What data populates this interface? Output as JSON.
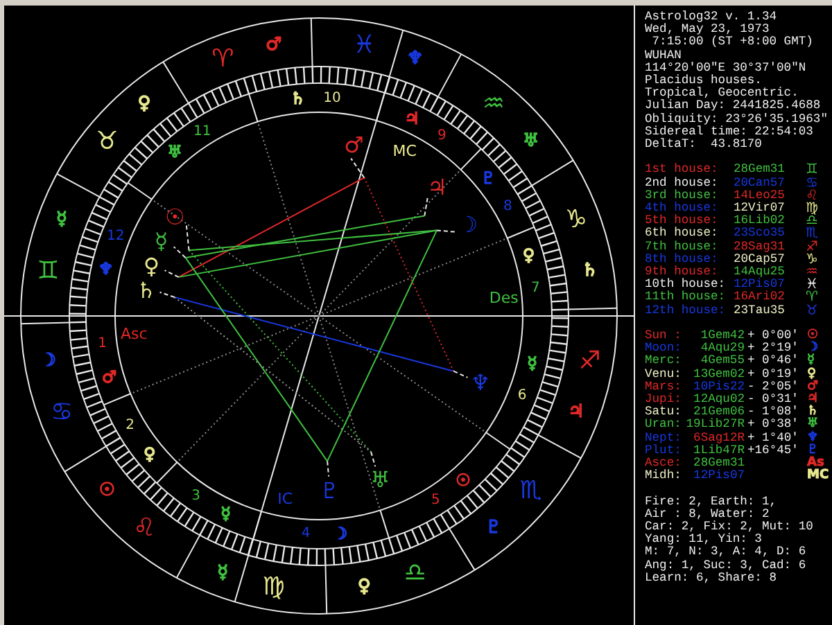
{
  "chart": {
    "signs": [
      {
        "glyph": "♈",
        "color": "#e02828"
      },
      {
        "glyph": "♉",
        "color": "#e8e890"
      },
      {
        "glyph": "♊",
        "color": "#40c040"
      },
      {
        "glyph": "♋",
        "color": "#1838e0"
      },
      {
        "glyph": "♌",
        "color": "#e02828"
      },
      {
        "glyph": "♍",
        "color": "#e8e890"
      },
      {
        "glyph": "♎",
        "color": "#40c040"
      },
      {
        "glyph": "♏",
        "color": "#1838e0"
      },
      {
        "glyph": "♐",
        "color": "#e02828"
      },
      {
        "glyph": "♑",
        "color": "#e8e890"
      },
      {
        "glyph": "♒",
        "color": "#40c040"
      },
      {
        "glyph": "♓",
        "color": "#1838e0"
      }
    ],
    "sign_rulers": [
      {
        "glyph": "♂",
        "color": "#e02828"
      },
      {
        "glyph": "♀",
        "color": "#e8e890"
      },
      {
        "glyph": "☿",
        "color": "#40c040"
      },
      {
        "glyph": "☽",
        "color": "#1838e0"
      },
      {
        "glyph": "☉",
        "color": "#e02828"
      },
      {
        "glyph": "☿",
        "color": "#40c040"
      },
      {
        "glyph": "♀",
        "color": "#e8e890"
      },
      {
        "glyph": "♇",
        "color": "#1838e0"
      },
      {
        "glyph": "♃",
        "color": "#e02828"
      },
      {
        "glyph": "♄",
        "color": "#e8e890"
      },
      {
        "glyph": "♅",
        "color": "#40c040"
      },
      {
        "glyph": "♆",
        "color": "#1838e0"
      }
    ],
    "houses": [
      {
        "number": "1",
        "color": "#e02828"
      },
      {
        "number": "2",
        "color": "#e8e890"
      },
      {
        "number": "3",
        "color": "#40c040"
      },
      {
        "number": "4",
        "color": "#1838e0"
      },
      {
        "number": "5",
        "color": "#e02828"
      },
      {
        "number": "6",
        "color": "#e8e890"
      },
      {
        "number": "7",
        "color": "#40c040"
      },
      {
        "number": "8",
        "color": "#1838e0"
      },
      {
        "number": "9",
        "color": "#e02828"
      },
      {
        "number": "10",
        "color": "#e8e890"
      },
      {
        "number": "11",
        "color": "#40c040"
      },
      {
        "number": "12",
        "color": "#1838e0"
      }
    ],
    "house_rulers": [
      {
        "glyph": "♂",
        "color": "#e02828"
      },
      {
        "glyph": "♀",
        "color": "#e8e890"
      },
      {
        "glyph": "☿",
        "color": "#40c040"
      },
      {
        "glyph": "☽",
        "color": "#1838e0"
      },
      {
        "glyph": "☉",
        "color": "#e02828"
      },
      {
        "glyph": "☿",
        "color": "#40c040"
      },
      {
        "glyph": "♀",
        "color": "#e8e890"
      },
      {
        "glyph": "♇",
        "color": "#1838e0"
      },
      {
        "glyph": "♃",
        "color": "#e02828"
      },
      {
        "glyph": "♄",
        "color": "#e8e890"
      },
      {
        "glyph": "♅",
        "color": "#40c040"
      },
      {
        "glyph": "♆",
        "color": "#1838e0"
      }
    ],
    "angles": [
      {
        "label": "Asc",
        "color": "#e02828"
      },
      {
        "label": "MC",
        "color": "#e8e890"
      },
      {
        "label": "Des",
        "color": "#40c040"
      },
      {
        "label": "IC",
        "color": "#1838e0"
      }
    ],
    "planets": [
      {
        "glyph": "☉",
        "color": "#e02828"
      },
      {
        "glyph": "☽",
        "color": "#1838e0"
      },
      {
        "glyph": "☿",
        "color": "#40c040"
      },
      {
        "glyph": "♀",
        "color": "#e8e890"
      },
      {
        "glyph": "♂",
        "color": "#e02828"
      },
      {
        "glyph": "♃",
        "color": "#e02828"
      },
      {
        "glyph": "♄",
        "color": "#e8e890"
      },
      {
        "glyph": "♅",
        "color": "#40c040"
      },
      {
        "glyph": "♆",
        "color": "#1838e0"
      },
      {
        "glyph": "♇",
        "color": "#1838e0"
      }
    ]
  },
  "info": {
    "header": [
      "Astrolog32 v. 1.34",
      "Wed, May 23, 1973",
      " 7:15:00 (ST +8:00 GMT)",
      "WUHAN",
      "114°20'00\"E 30°37'00\"N",
      "Placidus houses.",
      "Tropical, Geocentric.",
      "Julian Day: 2441825.4688",
      "Obliquity: 23°26'35.1963\"",
      "Sidereal time: 22:54:03",
      "DeltaT:  43.8170"
    ],
    "houses": [
      {
        "label": {
          "text": "1st house:",
          "color": "#e02828"
        },
        "value": {
          "text": "28Gem31",
          "color": "#40c040"
        },
        "glyph": {
          "text": "♊",
          "color": "#40c040"
        }
      },
      {
        "label": {
          "text": "2nd house:",
          "color": "#f0f0f0"
        },
        "value": {
          "text": "20Can57",
          "color": "#1838e0"
        },
        "glyph": {
          "text": "♋",
          "color": "#1838e0"
        }
      },
      {
        "label": {
          "text": "3rd house:",
          "color": "#40c040"
        },
        "value": {
          "text": "14Leo25",
          "color": "#e02828"
        },
        "glyph": {
          "text": "♌",
          "color": "#e02828"
        }
      },
      {
        "label": {
          "text": "4th house:",
          "color": "#1838e0"
        },
        "value": {
          "text": "12Vir07",
          "color": "#f0f0c8"
        },
        "glyph": {
          "text": "♍",
          "color": "#e8e890"
        }
      },
      {
        "label": {
          "text": "5th house:",
          "color": "#e02828"
        },
        "value": {
          "text": "16Lib02",
          "color": "#40c040"
        },
        "glyph": {
          "text": "♎",
          "color": "#40c040"
        }
      },
      {
        "label": {
          "text": "6th house:",
          "color": "#f0f0c8"
        },
        "value": {
          "text": "23Sco35",
          "color": "#1838e0"
        },
        "glyph": {
          "text": "♏",
          "color": "#1838e0"
        }
      },
      {
        "label": {
          "text": "7th house:",
          "color": "#40c040"
        },
        "value": {
          "text": "28Sag31",
          "color": "#e02828"
        },
        "glyph": {
          "text": "♐",
          "color": "#e02828"
        }
      },
      {
        "label": {
          "text": "8th house:",
          "color": "#1838e0"
        },
        "value": {
          "text": "20Cap57",
          "color": "#f0f0c8"
        },
        "glyph": {
          "text": "♑",
          "color": "#e8e890"
        }
      },
      {
        "label": {
          "text": "9th house:",
          "color": "#e02828"
        },
        "value": {
          "text": "14Aqu25",
          "color": "#40c040"
        },
        "glyph": {
          "text": "♒",
          "color": "#e02828"
        }
      },
      {
        "label": {
          "text": "10th house:",
          "color": "#f0f0f0"
        },
        "value": {
          "text": "12Pis07",
          "color": "#1838e0"
        },
        "glyph": {
          "text": "♓",
          "color": "#f0f0f0"
        }
      },
      {
        "label": {
          "text": "11th house:",
          "color": "#40c040"
        },
        "value": {
          "text": "16Ari02",
          "color": "#e02828"
        },
        "glyph": {
          "text": "♈",
          "color": "#40c040"
        }
      },
      {
        "label": {
          "text": "12th house:",
          "color": "#1838e0"
        },
        "value": {
          "text": "23Tau35",
          "color": "#f0f0c8"
        },
        "glyph": {
          "text": "♉",
          "color": "#1838e0"
        }
      }
    ],
    "planets": [
      {
        "label": {
          "text": "Sun :",
          "color": "#e02828"
        },
        "position": {
          "text": "1Gem42",
          "color": "#40c040"
        },
        "motion": "+ 0°00'",
        "glyph": {
          "text": "☉",
          "color": "#e02828"
        }
      },
      {
        "label": {
          "text": "Moon:",
          "color": "#1838e0"
        },
        "position": {
          "text": "4Aqu29",
          "color": "#40c040"
        },
        "motion": "+ 2°19'",
        "glyph": {
          "text": "☽",
          "color": "#1838e0"
        }
      },
      {
        "label": {
          "text": "Merc:",
          "color": "#40c040"
        },
        "position": {
          "text": "4Gem55",
          "color": "#40c040"
        },
        "motion": "+ 0°46'",
        "glyph": {
          "text": "☿",
          "color": "#40c040"
        }
      },
      {
        "label": {
          "text": "Venu:",
          "color": "#f0f0c8"
        },
        "position": {
          "text": "13Gem02",
          "color": "#40c040"
        },
        "motion": "+ 0°19'",
        "glyph": {
          "text": "♀",
          "color": "#e8e890"
        }
      },
      {
        "label": {
          "text": "Mars:",
          "color": "#e02828"
        },
        "position": {
          "text": "10Pis22",
          "color": "#1838e0"
        },
        "motion": "- 2°05'",
        "glyph": {
          "text": "♂",
          "color": "#e02828"
        }
      },
      {
        "label": {
          "text": "Jupi:",
          "color": "#e02828"
        },
        "position": {
          "text": "12Aqu02",
          "color": "#40c040"
        },
        "motion": "- 0°31'",
        "glyph": {
          "text": "♃",
          "color": "#e02828"
        }
      },
      {
        "label": {
          "text": "Satu:",
          "color": "#f0f0c8"
        },
        "position": {
          "text": "21Gem06",
          "color": "#40c040"
        },
        "motion": "- 1°08'",
        "glyph": {
          "text": "♄",
          "color": "#e8e890"
        }
      },
      {
        "label": {
          "text": "Uran:",
          "color": "#40c040"
        },
        "position": {
          "text": "19Lib27R",
          "color": "#40c040"
        },
        "motion": "+ 0°38'",
        "glyph": {
          "text": "♅",
          "color": "#40c040"
        }
      },
      {
        "label": {
          "text": "Nept:",
          "color": "#1838e0"
        },
        "position": {
          "text": "6Sag12R",
          "color": "#e02828"
        },
        "motion": "+ 1°40'",
        "glyph": {
          "text": "♆",
          "color": "#1838e0"
        }
      },
      {
        "label": {
          "text": "Plut:",
          "color": "#1838e0"
        },
        "position": {
          "text": "1Lib47R",
          "color": "#40c040"
        },
        "motion": "+16°45'",
        "glyph": {
          "text": "♇",
          "color": "#1838e0"
        }
      },
      {
        "label": {
          "text": "Asce:",
          "color": "#e02828"
        },
        "position": {
          "text": "28Gem31",
          "color": "#40c040"
        },
        "glyph": {
          "text": "As",
          "color": "#e02828"
        }
      },
      {
        "label": {
          "text": "Midh:",
          "color": "#f0f0c8"
        },
        "position": {
          "text": "12Pis07",
          "color": "#1838e0"
        },
        "glyph": {
          "text": "MC",
          "color": "#e8e890"
        }
      }
    ],
    "stats": [
      "Fire: 2, Earth: 1,",
      "Air : 8, Water: 2",
      "Car: 2, Fix: 2, Mut: 10",
      "Yang: 11, Yin: 3",
      "M: 7, N: 3, A: 4, D: 6",
      "Ang: 1, Suc: 3, Cad: 6",
      "Learn: 6, Share: 8"
    ]
  }
}
